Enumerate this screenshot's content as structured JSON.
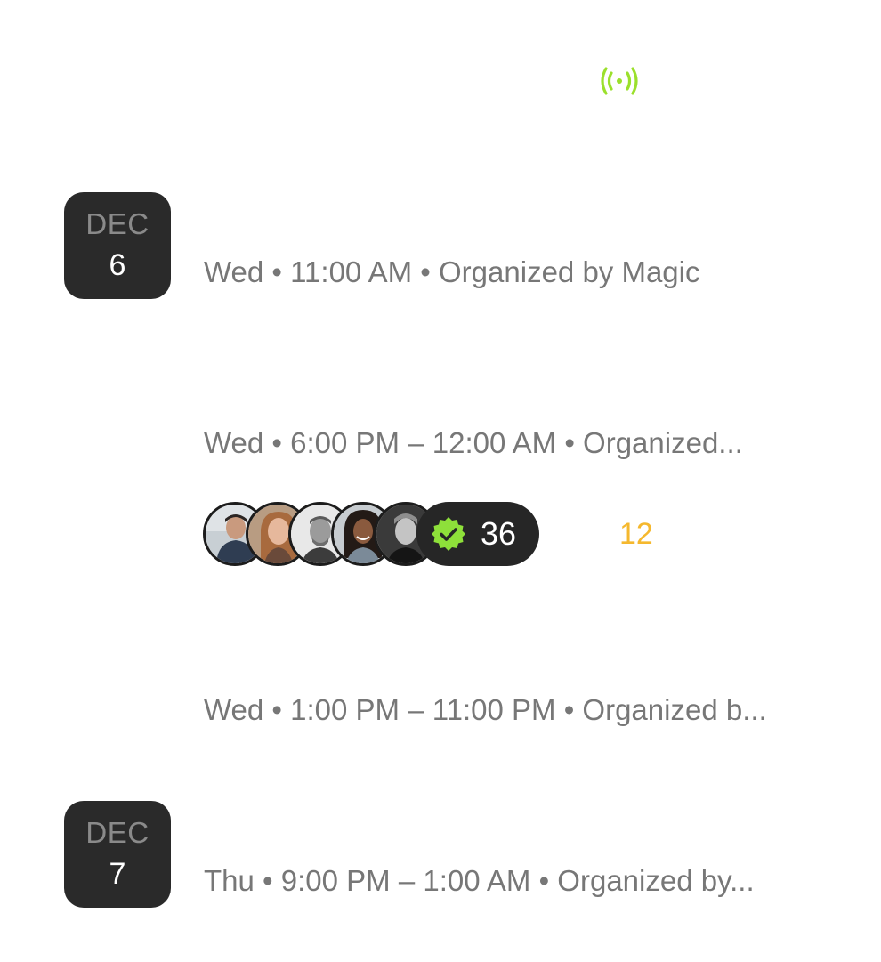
{
  "live_indicator": {
    "icon": "broadcast-icon",
    "color": "#9be02c"
  },
  "date_groups": [
    {
      "month": "DEC",
      "day": "6"
    },
    {
      "month": "DEC",
      "day": "7"
    }
  ],
  "events": [
    {
      "meta": "Wed • 11:00 AM • Organized by Magic"
    },
    {
      "meta": "Wed • 6:00 PM – 12:00 AM • Organized..."
    },
    {
      "meta": "Wed • 1:00 PM – 11:00 PM • Organized b..."
    },
    {
      "meta": "Thu • 9:00 PM – 1:00 AM • Organized by..."
    }
  ],
  "attendees": {
    "avatar_count": 5,
    "going_count": "36",
    "badge_icon": "verified-check-icon",
    "badge_color": "#8ee03a"
  },
  "side_count": {
    "value": "12",
    "color": "#f5b82e"
  }
}
